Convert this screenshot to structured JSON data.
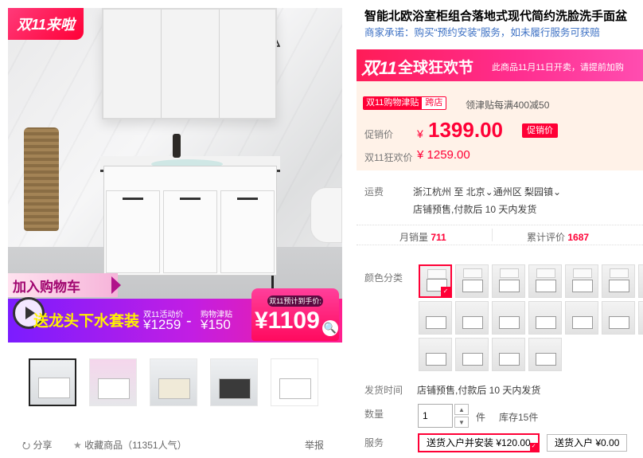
{
  "gallery": {
    "badge": "双11来啦",
    "cart_cta": "加入购物车",
    "promo_title": "送龙头下水套装",
    "activity_label": "双11活动价",
    "activity_price": "¥1259",
    "minus": "-",
    "jintie_label": "购物津贴",
    "jintie_price": "¥150",
    "final_label": "双11预计到手价:",
    "final_price": "¥1109",
    "thumbnails": [
      "thumb-1",
      "thumb-2",
      "thumb-3",
      "thumb-4",
      "thumb-5"
    ]
  },
  "actions": {
    "share": "分享",
    "favorite": "收藏商品（11351人气）",
    "report": "举报"
  },
  "product": {
    "title": "智能北欧浴室柜组合落地式现代简约洗脸洗手面盆",
    "subtitle": "商家承诺：购买“预约安装”服务，如未履行服务可获赔"
  },
  "banner": {
    "logo": "双11",
    "headline": "全球狂欢节",
    "note": "此商品11月11日开卖，请提前加购"
  },
  "pricing": {
    "jt_main": "双11购物津贴",
    "jt_sub": "跨店",
    "jt_desc": "领津贴每满400减50",
    "price_label": "促销价",
    "currency": "¥",
    "price": "1399.00",
    "price_tag": "促销价",
    "double11_label": "双11狂欢价",
    "double11_price": "¥ 1259.00"
  },
  "shipping": {
    "label": "运费",
    "route": "浙江杭州  至 北京⌄通州区  梨园镇⌄",
    "note": "店铺预售,付款后 10 天内发货"
  },
  "stats": {
    "sales_label": "月销量",
    "sales_value": "711",
    "reviews_label": "累计评价",
    "reviews_value": "1687"
  },
  "options": {
    "color_label": "颜色分类",
    "delivery_label": "发货时间",
    "delivery_value": "店铺预售,付款后 10 天内发货",
    "qty_label": "数量",
    "qty_value": "1",
    "qty_up": "▲",
    "qty_down": "▼",
    "unit": "件",
    "stock": "库存15件",
    "service_label": "服务",
    "service_1": "送货入户并安装 ¥120.00",
    "service_2": "送货入户 ¥0.00"
  },
  "colors": {
    "brand": "#ff0036",
    "link": "#3d71c4",
    "price_bg": "#fff2e8"
  }
}
